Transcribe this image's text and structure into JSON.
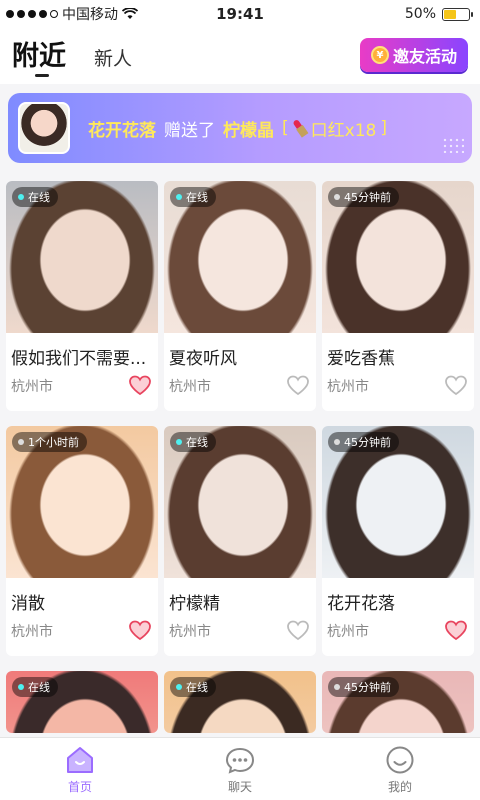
{
  "status_bar": {
    "carrier": "中国移动",
    "time": "19:41",
    "battery": "50%",
    "battery_level": 0.5
  },
  "header": {
    "tab_active": "附近",
    "tab_inactive": "新人",
    "invite_label": "邀友活动"
  },
  "banner": {
    "sender": "花开花落",
    "verb": "赠送了",
    "receiver": "柠檬晶",
    "gift_open": "[",
    "gift_name": "口红x18",
    "gift_close": "]"
  },
  "cards": [
    {
      "status": "在线",
      "online": true,
      "name": "假如我们不需要...",
      "city": "杭州市",
      "liked": true,
      "colors": [
        "#b9bcc2",
        "#5b4233",
        "#efd9cc"
      ]
    },
    {
      "status": "在线",
      "online": true,
      "name": "夏夜听风",
      "city": "杭州市",
      "liked": false,
      "colors": [
        "#e8dcd4",
        "#6b4a3a",
        "#f5e6de"
      ]
    },
    {
      "status": "45分钟前",
      "online": false,
      "name": "爱吃香蕉",
      "city": "杭州市",
      "liked": false,
      "colors": [
        "#e6d6cc",
        "#4a3229",
        "#f3e3db"
      ]
    },
    {
      "status": "1个小时前",
      "online": false,
      "name": "消散",
      "city": "杭州市",
      "liked": true,
      "colors": [
        "#f3c9a0",
        "#8a5a3a",
        "#fbe4d2"
      ]
    },
    {
      "status": "在线",
      "online": true,
      "name": "柠檬精",
      "city": "杭州市",
      "liked": false,
      "colors": [
        "#d9cabf",
        "#5a3d30",
        "#f0e2da"
      ]
    },
    {
      "status": "45分钟前",
      "online": false,
      "name": "花开花落",
      "city": "杭州市",
      "liked": true,
      "colors": [
        "#cfd8e0",
        "#3d2f2a",
        "#eef1f4"
      ]
    },
    {
      "status": "在线",
      "online": true,
      "name": "",
      "city": "",
      "liked": false,
      "colors": [
        "#f07a7a",
        "#3a2a2a",
        "#f4b7a6"
      ]
    },
    {
      "status": "在线",
      "online": true,
      "name": "",
      "city": "",
      "liked": false,
      "colors": [
        "#f2c18a",
        "#3b2a22",
        "#f5d9c2"
      ]
    },
    {
      "status": "45分钟前",
      "online": false,
      "name": "",
      "city": "",
      "liked": false,
      "colors": [
        "#e9b7b7",
        "#5b3b2e",
        "#f4d4cc"
      ]
    }
  ],
  "nav": [
    {
      "label": "首页",
      "icon": "home-icon",
      "active": true
    },
    {
      "label": "聊天",
      "icon": "chat-icon",
      "active": false
    },
    {
      "label": "我的",
      "icon": "profile-icon",
      "active": false
    }
  ],
  "colors": {
    "accent": "#9b6cff",
    "liked": "#e8455f",
    "banner_highlight": "#ffe95a"
  }
}
